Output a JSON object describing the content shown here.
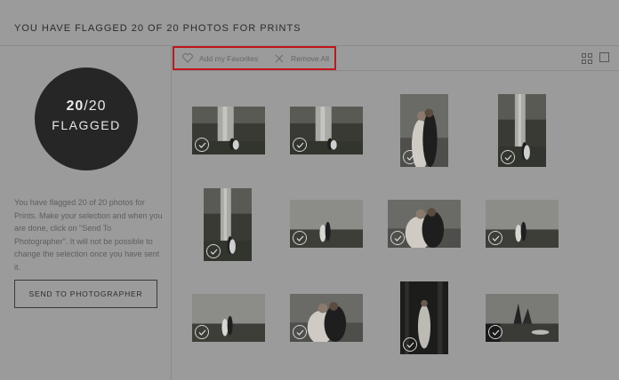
{
  "header": {
    "title": "YOU HAVE FLAGGED 20 OF 20 PHOTOS FOR PRINTS"
  },
  "sidebar": {
    "count": "20",
    "total": "/20",
    "flag_label": "FLAGGED",
    "description": "You have flagged 20 of 20 photos for Prints. Make your selection and when you are done, click on \"Send To Photographer\". It will not be possible to change the selection once you have sent it.",
    "send_button": "SEND TO PHOTOGRAPHER"
  },
  "toolbar": {
    "add_favorites": "Add my Favorites",
    "remove_all": "Remove All"
  },
  "colors": {
    "highlight": "#c4151b",
    "overlay": "#9b9b9b",
    "dark": "#262626"
  },
  "photos": [
    {
      "scene": "waterfall",
      "orientation": "landscape",
      "selected": true
    },
    {
      "scene": "waterfall",
      "orientation": "landscape",
      "selected": true
    },
    {
      "scene": "couple-closeup",
      "orientation": "portrait",
      "selected": true
    },
    {
      "scene": "waterfall",
      "orientation": "portrait",
      "selected": true
    },
    {
      "scene": "waterfall",
      "orientation": "portrait",
      "selected": true
    },
    {
      "scene": "foggy-field",
      "orientation": "landscape",
      "selected": true
    },
    {
      "scene": "couple-closeup",
      "orientation": "landscape",
      "selected": true
    },
    {
      "scene": "foggy-field",
      "orientation": "landscape",
      "selected": true
    },
    {
      "scene": "foggy-field",
      "orientation": "landscape",
      "selected": true
    },
    {
      "scene": "couple-closeup",
      "orientation": "landscape",
      "selected": true
    },
    {
      "scene": "dark-forest",
      "orientation": "portrait",
      "selected": true
    },
    {
      "scene": "sea-stacks",
      "orientation": "landscape",
      "selected": true
    }
  ]
}
